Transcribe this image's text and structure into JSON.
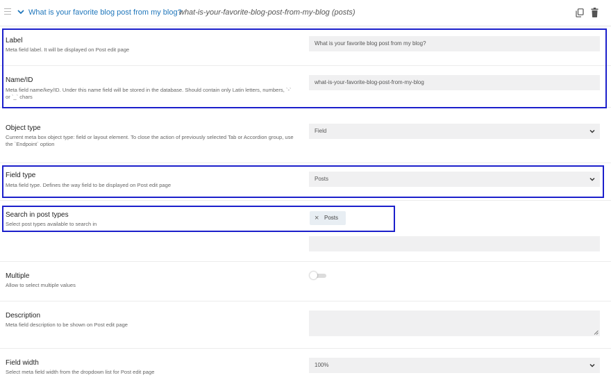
{
  "header": {
    "title": "What is your favorite blog post from my blog?",
    "slug": "what-is-your-favorite-blog-post-from-my-blog (posts)",
    "icons": [
      "drag-handle-icon",
      "chevron-down-icon",
      "copy-icon",
      "trash-icon"
    ]
  },
  "fields": {
    "label": {
      "title": "Label",
      "desc": "Meta field label. It will be displayed on Post edit page",
      "value": "What is your favorite blog post from my blog?"
    },
    "name_id": {
      "title": "Name/ID",
      "desc": "Meta field name/key/ID. Under this name field will be stored in the database. Should contain only Latin letters, numbers, `-` or `_` chars",
      "value": "what-is-your-favorite-blog-post-from-my-blog"
    },
    "object_type": {
      "title": "Object type",
      "desc": "Current meta box object type: field or layout element. To close the action of previously selected Tab or Accordion group, use the `Endpoint` option",
      "value": "Field"
    },
    "field_type": {
      "title": "Field type",
      "desc": "Meta field type. Defines the way field to be displayed on Post edit page",
      "value": "Posts"
    },
    "search_post_types": {
      "title": "Search in post types",
      "desc": "Select post types available to search in",
      "tag_remove": "×",
      "tags": [
        "Posts"
      ]
    },
    "multiple": {
      "title": "Multiple",
      "desc": "Allow to select multiple values",
      "enabled": false
    },
    "description": {
      "title": "Description",
      "desc": "Meta field description to be shown on Post edit page",
      "value": ""
    },
    "field_width": {
      "title": "Field width",
      "desc": "Select meta field width from the dropdown list for Post edit page",
      "value": "100%"
    }
  },
  "colors": {
    "accent_link": "#1f76bb",
    "highlight_border": "#1b1fcb",
    "input_bg": "#f0f0f1"
  }
}
